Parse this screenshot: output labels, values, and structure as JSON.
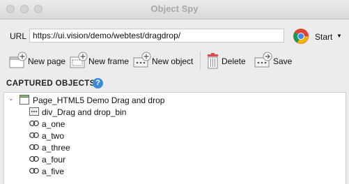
{
  "window": {
    "title": "Object Spy"
  },
  "url_bar": {
    "label": "URL",
    "value": "https://ui.vision/demo/webtest/dragdrop/"
  },
  "start": {
    "label": "Start"
  },
  "toolbar": {
    "new_page": "New page",
    "new_frame": "New frame",
    "new_object": "New object",
    "delete": "Delete",
    "save": "Save"
  },
  "captured": {
    "heading": "CAPTURED OBJECTS",
    "help": "?"
  },
  "tree": {
    "page": "Page_HTML5 Demo Drag and drop",
    "children": [
      "div_Drag and drop_bin",
      "a_one",
      "a_two",
      "a_three",
      "a_four",
      "a_five"
    ]
  }
}
